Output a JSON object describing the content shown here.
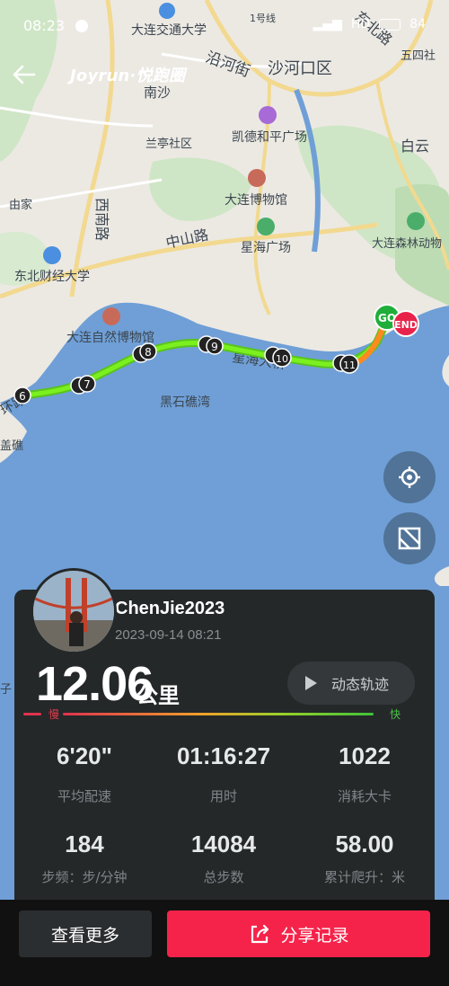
{
  "status_bar": {
    "time": "08:23",
    "network": "HD",
    "battery": "84"
  },
  "header": {
    "brand": "Joyrun·悦跑圈"
  },
  "map": {
    "labels": {
      "dalian_jiaotong": "大连交通大学",
      "yanhe_street": "沿河街",
      "shahekou": "沙河口区",
      "nansha": "南沙",
      "kaide": "凯德和平广场",
      "lanting": "兰亭社区",
      "museum": "大连博物馆",
      "xinan_road": "西南路",
      "zhongshan_road": "中山路",
      "xinghai_square": "星海广场",
      "dongcai": "东北财经大学",
      "natural_museum": "大连自然博物馆",
      "heishijiao": "黑石礁湾",
      "xinghai_bridge": "星海大桥",
      "forest_zoo": "大连森林动物",
      "baiyun": "白云",
      "wusi": "五四社",
      "dongbei_road": "东北路",
      "line1": "1号线",
      "youjia": "由家",
      "huan_road": "环路",
      "gaijiao": "盖礁",
      "zi": "子"
    },
    "markers": [
      "6",
      "7",
      "8",
      "9",
      "10",
      "11"
    ],
    "start_label": "GO",
    "end_label": "END"
  },
  "card": {
    "username": "ChenJie2023",
    "datetime": "2023-09-14 08:21",
    "distance": "12.06",
    "distance_unit": "公里",
    "replay_label": "动态轨迹",
    "slow_label": "慢",
    "fast_label": "快",
    "stats": [
      {
        "value": "6'20\"",
        "label": "平均配速"
      },
      {
        "value": "01:16:27",
        "label": "用时"
      },
      {
        "value": "1022",
        "label": "消耗大卡"
      },
      {
        "value": "184",
        "label": "步频：步/分钟"
      },
      {
        "value": "14084",
        "label": "总步数"
      },
      {
        "value": "58.00",
        "label": "累计爬升：米"
      }
    ]
  },
  "bottom": {
    "more_label": "查看更多",
    "share_label": "分享记录"
  },
  "colors": {
    "route_green": "#6fe01a",
    "route_orange": "#ff8a1f",
    "share_red": "#f5234a",
    "card_bg": "#252829"
  }
}
